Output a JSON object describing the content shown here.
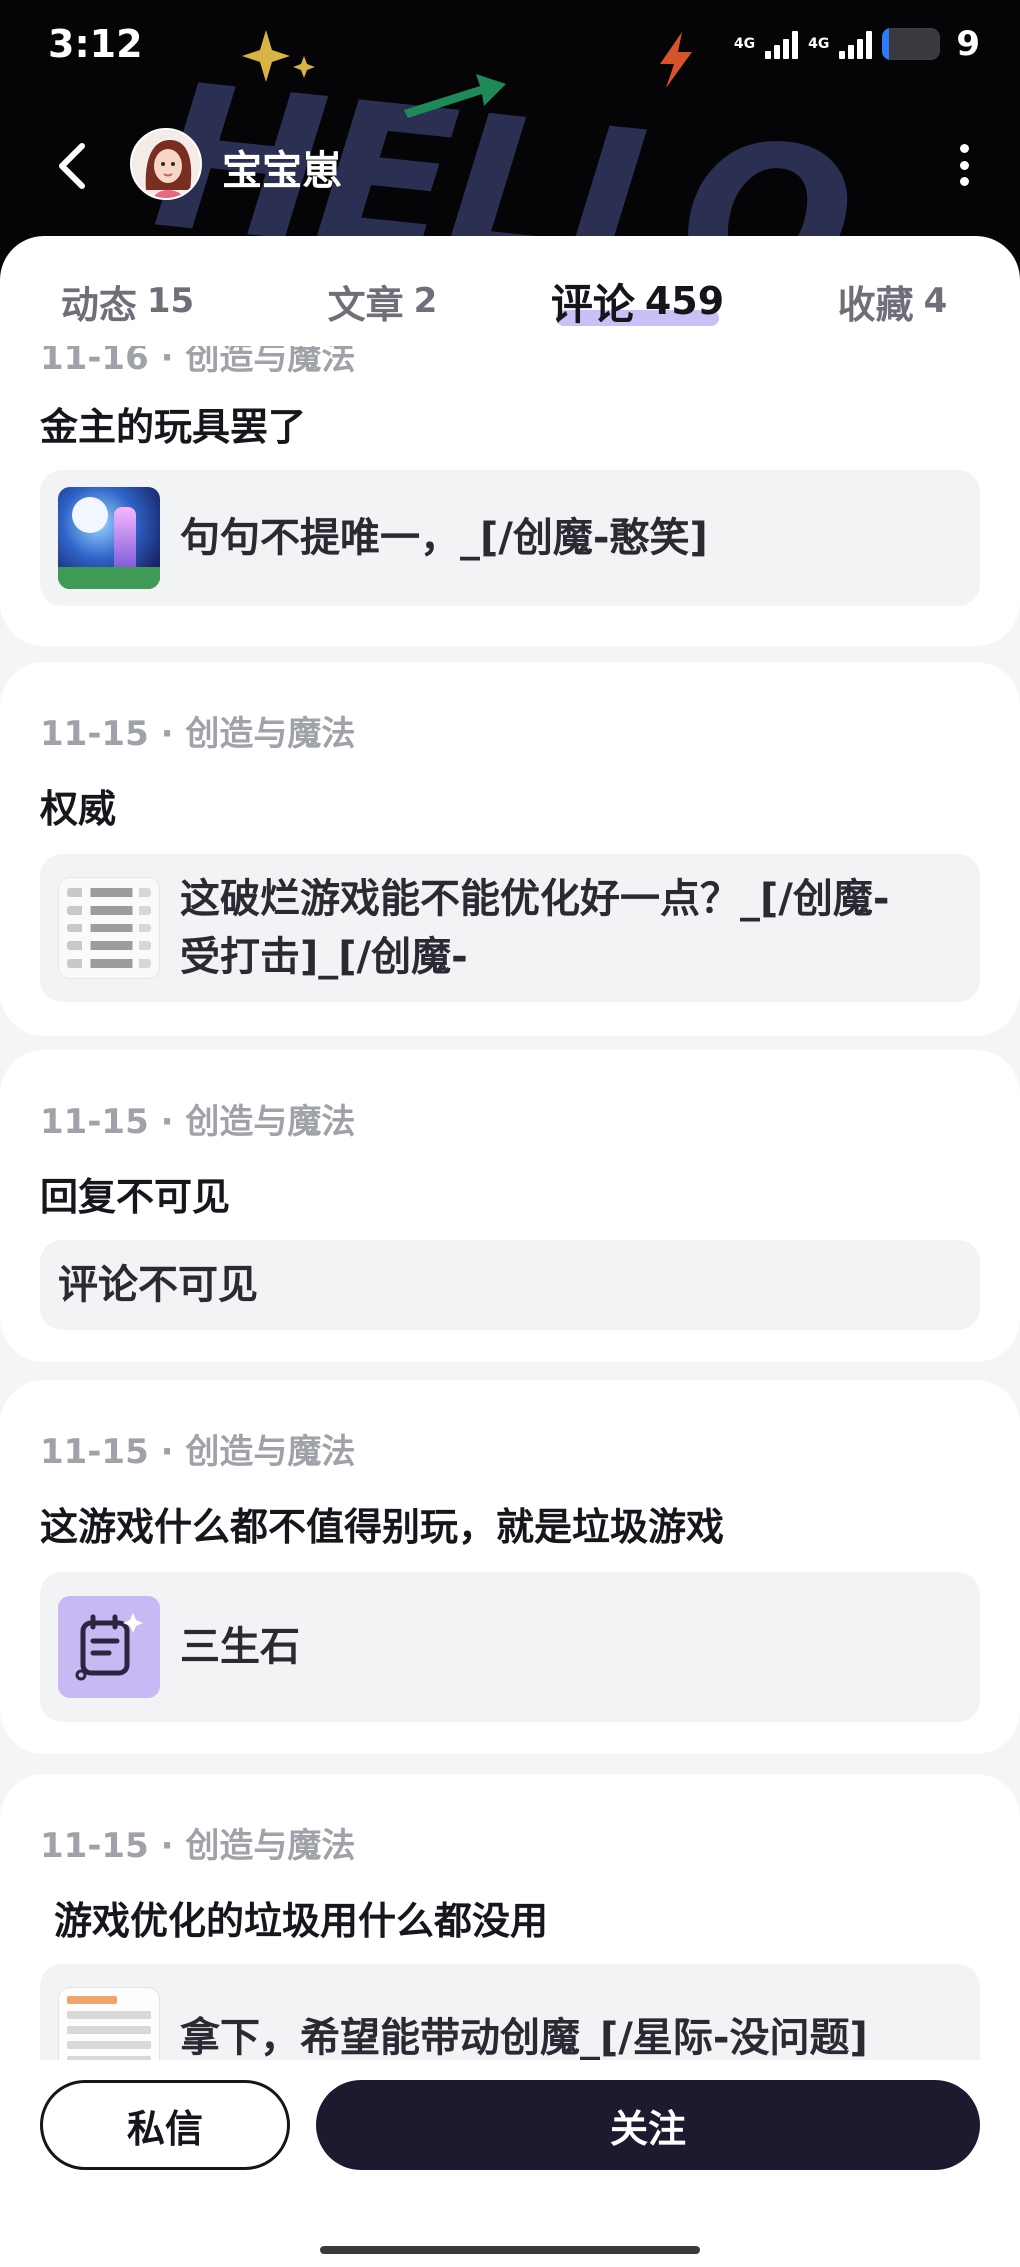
{
  "status_bar": {
    "time": "3:12",
    "network_1": "4G",
    "network_2": "4G",
    "battery_level": "9",
    "battery_fraction": 0.09
  },
  "header": {
    "username": "宝宝崽",
    "background_art_text": "HELLO."
  },
  "tabs": [
    {
      "label": "动态",
      "count": "15",
      "active": false
    },
    {
      "label": "文章",
      "count": "2",
      "active": false
    },
    {
      "label": "评论",
      "count": "459",
      "active": true
    },
    {
      "label": "收藏",
      "count": "4",
      "active": false
    }
  ],
  "comments": [
    {
      "meta": "11-16 · 创造与魔法",
      "title": "金主的玩具罢了",
      "quote": "句句不提唯一，_[/创魔-憨笑]",
      "thumb": "game-screenshot-thumbnail"
    },
    {
      "meta": "11-15 · 创造与魔法",
      "title": "权威",
      "quote": "这破烂游戏能不能优化好一点？_[/创魔-受打击]_[/创魔-",
      "thumb": "list-screenshot-thumbnail"
    },
    {
      "meta": "11-15 · 创造与魔法",
      "title": "回复不可见",
      "quote": "评论不可见",
      "thumb": ""
    },
    {
      "meta": "11-15 · 创造与魔法",
      "title": "这游戏什么都不值得别玩，就是垃圾游戏",
      "quote": "三生石",
      "thumb": "note-icon"
    },
    {
      "meta": "11-15 · 创造与魔法",
      "title": "游戏优化的垃圾用什么都没用",
      "quote": "拿下，希望能带动创魔_[/星际-没问题]",
      "thumb": "document-screenshot-thumbnail"
    }
  ],
  "bottom_bar": {
    "message_label": "私信",
    "follow_label": "关注"
  },
  "colors": {
    "header_bg": "#050508",
    "tab_highlight": "#b8a9f3",
    "follow_bg": "#1b1a2e",
    "page_bg": "#f4f5f7"
  }
}
